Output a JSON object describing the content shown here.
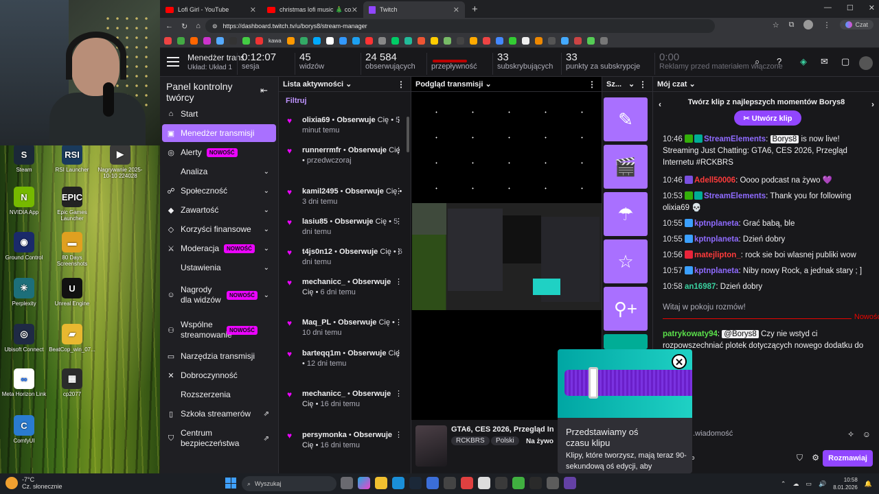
{
  "desktop": {
    "icons": [
      {
        "label": "Steam",
        "color": "#1b2838",
        "glyph": "S"
      },
      {
        "label": "RSI Launcher",
        "color": "#1a3a5c",
        "glyph": "RSI"
      },
      {
        "label": "Nagrywanie 2025-10-10 224028",
        "color": "#3a3a3a",
        "glyph": "▶"
      },
      {
        "label": "NVIDIA App",
        "color": "#76b900",
        "glyph": "N"
      },
      {
        "label": "Epic Games Launcher",
        "color": "#222",
        "glyph": "EPIC"
      },
      {
        "label": "Ground Control",
        "color": "#1a2a6a",
        "glyph": "◉"
      },
      {
        "label": "80 Days Screenshots",
        "color": "#e0a020",
        "glyph": "▬"
      },
      {
        "label": "Perplexity",
        "color": "#1d6f7a",
        "glyph": "✳"
      },
      {
        "label": "Unreal Engine",
        "color": "#111",
        "glyph": "U"
      },
      {
        "label": "Ubisoft Connect",
        "color": "#1f2a44",
        "glyph": "◎"
      },
      {
        "label": "BeatCop_win_07...",
        "color": "#e8b830",
        "glyph": "▰"
      },
      {
        "label": "Meta Horizon Link",
        "color": "#fff",
        "glyph": "∞"
      },
      {
        "label": "cp2077",
        "color": "#2b2b2b",
        "glyph": "▦"
      },
      {
        "label": "ComfyUI",
        "color": "#2a7bd0",
        "glyph": "C"
      }
    ]
  },
  "taskbar": {
    "temperature": "-7°C",
    "weather": "Cz. słonecznie",
    "search_placeholder": "Wyszukaj",
    "time": "10:58",
    "date": "8.01.2026"
  },
  "browser": {
    "tabs": [
      {
        "title": "Lofi Girl - YouTube",
        "icon": "youtube-icon",
        "active": false
      },
      {
        "title": "christmas lofi music 🎄 cozy r...",
        "icon": "youtube-icon",
        "active": false
      },
      {
        "title": "Twitch",
        "icon": "twitch-icon",
        "active": true
      }
    ],
    "url": "https://dashboard.twitch.tv/u/borys8/stream-manager",
    "chat_button": "Czat",
    "bookmark_label": "kawa"
  },
  "topbar": {
    "title": "Menedżer transmisji",
    "layout": "Układ: Układ 1",
    "stats": [
      {
        "value": "0:12:07",
        "label": "sesja"
      },
      {
        "value": "45",
        "label": "widzów"
      },
      {
        "value": "24 584",
        "label": "obserwujących"
      },
      {
        "value": "",
        "label": "przepływność"
      },
      {
        "value": "33",
        "label": "subskrybujących"
      },
      {
        "value": "33",
        "label": "punkty za subskrypcje"
      },
      {
        "value": "0:00",
        "label": "Reklamy przed materiałem włączone"
      }
    ]
  },
  "sidenav": {
    "heading": "Panel kontrolny twórcy",
    "items": [
      {
        "label": "Start",
        "icon": "home-icon",
        "badge": "",
        "chevron": false,
        "active": false
      },
      {
        "label": "Menedżer transmisji",
        "icon": "stream-manager-icon",
        "badge": "",
        "chevron": false,
        "active": true
      },
      {
        "label": "Alerty",
        "icon": "alerts-icon",
        "badge": "NOWOŚĆ",
        "chevron": false,
        "active": false
      },
      {
        "label": "Analiza",
        "icon": "analytics-icon",
        "badge": "",
        "chevron": true,
        "active": false
      },
      {
        "label": "Społeczność",
        "icon": "community-icon",
        "badge": "",
        "chevron": true,
        "active": false
      },
      {
        "label": "Zawartość",
        "icon": "content-icon",
        "badge": "",
        "chevron": true,
        "active": false
      },
      {
        "label": "Korzyści finansowe",
        "icon": "monetization-icon",
        "badge": "",
        "chevron": true,
        "active": false
      },
      {
        "label": "Moderacja",
        "icon": "moderation-icon",
        "badge": "NOWOŚĆ",
        "chevron": true,
        "active": false
      },
      {
        "label": "Ustawienia",
        "icon": "settings-icon",
        "badge": "",
        "chevron": true,
        "active": false
      },
      {
        "label": "Nagrody dla widzów",
        "icon": "rewards-icon",
        "badge": "NOWOŚĆ",
        "chevron": true,
        "active": false
      },
      {
        "label": "Wspólne streamowanie",
        "icon": "collab-icon",
        "badge": "NOWOŚĆ",
        "chevron": false,
        "active": false
      },
      {
        "label": "Narzędzia transmisji",
        "icon": "tools-icon",
        "badge": "",
        "chevron": false,
        "active": false
      },
      {
        "label": "Dobroczynność",
        "icon": "charity-icon",
        "badge": "",
        "chevron": false,
        "active": false
      },
      {
        "label": "Rozszerzenia",
        "icon": "extensions-icon",
        "badge": "",
        "chevron": false,
        "active": false
      },
      {
        "label": "Szkoła streamerów",
        "icon": "school-icon",
        "badge": "",
        "chevron": false,
        "external": true,
        "active": false
      },
      {
        "label": "Centrum bezpieczeństwa",
        "icon": "safety-icon",
        "badge": "",
        "chevron": false,
        "external": true,
        "active": false
      }
    ]
  },
  "activity": {
    "title": "Lista aktywności",
    "filter": "Filtruj",
    "events": [
      {
        "user": "olixia69",
        "action": "Obserwuje",
        "prefix": "Cię",
        "time": "5 minut temu"
      },
      {
        "user": "runnerrmfr",
        "action": "Obserwuje",
        "prefix": "Cię",
        "time": "przedwczoraj"
      },
      {
        "user": "kamil2495",
        "action": "Obserwuje",
        "prefix": "Cię",
        "time": "3 dni temu"
      },
      {
        "user": "lasiu85",
        "action": "Obserwuje",
        "prefix": "Cię",
        "time": "5 dni temu"
      },
      {
        "user": "t4js0n12",
        "action": "Obserwuje",
        "prefix": "Cię",
        "time": "6 dni temu"
      },
      {
        "user": "mechanicc_",
        "action": "Obserwuje",
        "prefix": "Cię",
        "time": "6 dni temu"
      },
      {
        "user": "Maq_PL",
        "action": "Obserwuje",
        "prefix": "Cię",
        "time": "10 dni temu"
      },
      {
        "user": "barteqq1m",
        "action": "Obserwuje",
        "prefix": "Cię",
        "time": "12 dni temu"
      },
      {
        "user": "mechanicc_",
        "action": "Obserwuje",
        "prefix": "Cię",
        "time": "16 dni temu"
      },
      {
        "user": "persymonka",
        "action": "Obserwuje",
        "prefix": "Cię",
        "time": "16 dni temu"
      }
    ]
  },
  "preview": {
    "title": "Podgląd transmisji",
    "stream_title": "GTA6, CES 2026, Przegląd In",
    "tags": [
      "RCKBRS",
      "Polski"
    ],
    "live": "Na żywo"
  },
  "quick_actions": {
    "title": "Sz...",
    "buttons": [
      "edit-icon",
      "clapperboard-icon",
      "umbrella-icon",
      "star-icon",
      "add-user-icon"
    ]
  },
  "chat": {
    "title": "Mój czat",
    "clip_prompt": "Twórz klip z najlepszych momentów Borys8",
    "clip_button": "Utwórz klip",
    "messages": [
      {
        "time": "10:46",
        "user": "StreamElements",
        "color": "#8f6bff",
        "text": "",
        "mention": "Borys8",
        "after": " is now live! Streaming Just Chatting: GTA6, CES 2026, Przegląd Internetu #RCKBRS"
      },
      {
        "time": "10:46",
        "user": "Adell50006",
        "color": "#ff3b3b",
        "text": "Oooo podcast na żywo 💜",
        "mention": "",
        "after": ""
      },
      {
        "time": "10:53",
        "user": "StreamElements",
        "color": "#8f6bff",
        "text": "Thank you for following olixia69 💀",
        "mention": "",
        "after": ""
      },
      {
        "time": "10:55",
        "user": "kptnplaneta",
        "color": "#8f6bff",
        "text": "Grać babą, ble",
        "mention": "",
        "after": ""
      },
      {
        "time": "10:55",
        "user": "kptnplaneta",
        "color": "#8f6bff",
        "text": "Dzień dobry",
        "mention": "",
        "after": ""
      },
      {
        "time": "10:56",
        "user": "matejlipton_",
        "color": "#ff3b3b",
        "text": "rock sie boi wlasnej publiki wow",
        "mention": "",
        "after": ""
      },
      {
        "time": "10:57",
        "user": "kptnplaneta",
        "color": "#8f6bff",
        "text": "Niby nowy Rock, a jednak stary ; ]",
        "mention": "",
        "after": ""
      },
      {
        "time": "10:58",
        "user": "an16987",
        "color": "#3ad1a0",
        "text": "Dzień dobry",
        "mention": "",
        "after": ""
      }
    ],
    "welcome": "Witaj w pokoju rozmów!",
    "new_label": "Nowość",
    "new_message": {
      "user": "patrykowaty94",
      "color": "#5ae04a",
      "mention": "@Borys8",
      "text": " Czy nie wstyd ci rozpowszechniać plotek dotyczących nowego dodatku do ...na 3?"
    },
    "input_placeholder": "...wiadomość",
    "send_button": "Rozmawiaj"
  },
  "popup": {
    "title": "Przedstawiamy oś czasu klipu",
    "body": "Klipy, które tworzysz, mają teraz 90-sekundową oś edycji, aby"
  }
}
